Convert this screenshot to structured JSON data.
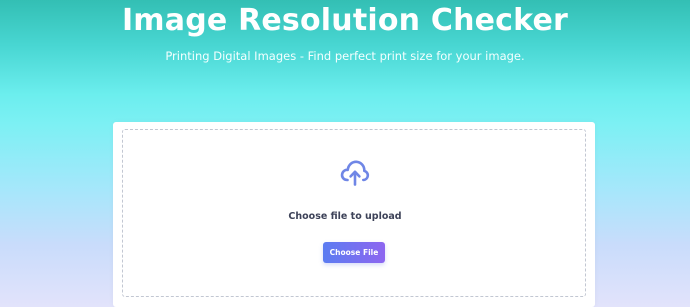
{
  "header": {
    "title": "Image Resolution Checker",
    "subtitle": "Printing Digital Images - Find perfect print size for your image."
  },
  "upload": {
    "icon": "cloud-upload-icon",
    "prompt": "Choose file to upload",
    "button_label": "Choose File"
  },
  "colors": {
    "gradient_top": "#33bfb4",
    "gradient_mid": "#7df0f4",
    "gradient_bottom": "#e2e3fb",
    "icon": "#6f86e6",
    "button_start": "#5b7cf1",
    "button_end": "#8d66f0",
    "dropzone_border": "#c2c7d2"
  }
}
